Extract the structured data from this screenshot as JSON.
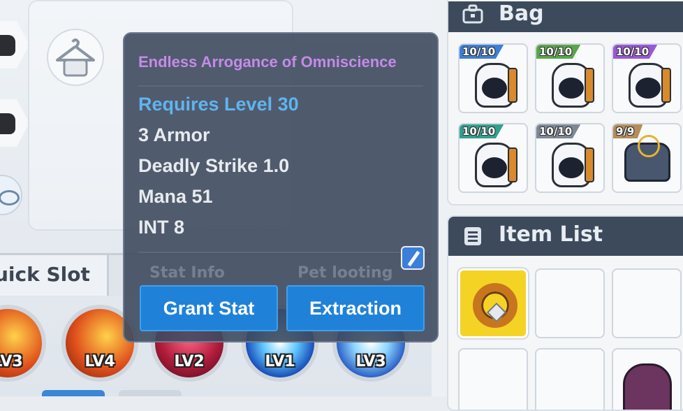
{
  "tooltip": {
    "item_name": "Endless Arrogance of Omniscience",
    "item_name_color": "#c58ae8",
    "requirement": "Requires Level 30",
    "stats": [
      "3 Armor",
      "Deadly Strike 1.0",
      "Mana 51",
      "INT 8"
    ],
    "tabs": [
      "Stat Info",
      "Pet looting"
    ],
    "buttons": {
      "grant_stat": "Grant Stat",
      "extraction": "Extraction"
    },
    "wand_icon": "wand-icon"
  },
  "quick_slot": {
    "label": "uick Slot",
    "skills": [
      {
        "level": "LV3",
        "icon": "fire-sword-skill-icon"
      },
      {
        "level": "LV4",
        "icon": "fire-sword-skill-icon"
      },
      {
        "level": "LV2",
        "icon": "crimson-skill-icon"
      },
      {
        "level": "LV1",
        "icon": "blue-burst-skill-icon"
      },
      {
        "level": "LV3",
        "icon": "blue-blade-skill-icon"
      }
    ]
  },
  "bag": {
    "title": "Bag",
    "icon": "bag-icon",
    "slots": [
      {
        "count": "10/10",
        "badge_color": "#3b7fd8",
        "item": "backpack-icon"
      },
      {
        "count": "10/10",
        "badge_color": "#5aa64a",
        "item": "backpack-icon"
      },
      {
        "count": "10/10",
        "badge_color": "#9a56d8",
        "item": "backpack-icon"
      },
      {
        "count": "10/10",
        "badge_color": "#2fa08e",
        "item": "backpack-icon"
      },
      {
        "count": "10/10",
        "badge_color": "#7e8794",
        "item": "backpack-icon"
      },
      {
        "count": "9/9",
        "badge_color": "#b58c5a",
        "item": "helmet-icon"
      }
    ]
  },
  "item_list": {
    "title": "Item List",
    "icon": "list-icon"
  }
}
